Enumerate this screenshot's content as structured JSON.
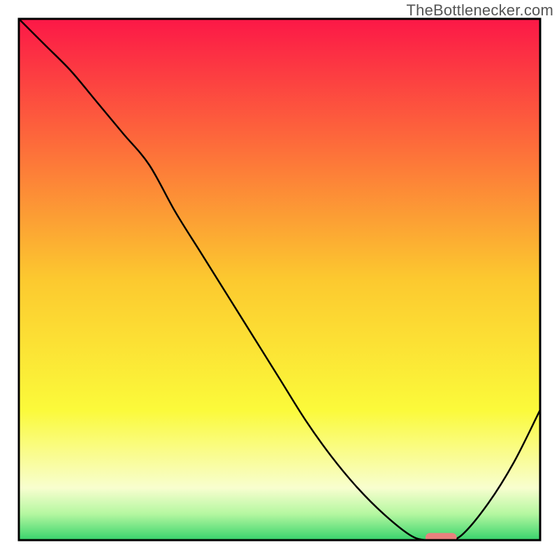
{
  "watermark": "TheBottlenecker.com",
  "chart_data": {
    "type": "line",
    "title": "",
    "xlabel": "",
    "ylabel": "",
    "xlim": [
      0,
      100
    ],
    "ylim": [
      0,
      100
    ],
    "grid": false,
    "legend": false,
    "x": [
      0,
      5,
      10,
      15,
      20,
      25,
      30,
      35,
      40,
      45,
      50,
      55,
      60,
      65,
      70,
      75,
      78,
      82,
      85,
      90,
      95,
      100
    ],
    "y": [
      100,
      95,
      90,
      84,
      78,
      72,
      63,
      55,
      47,
      39,
      31,
      23,
      16,
      10,
      5,
      1,
      0,
      0,
      1,
      7,
      15,
      25
    ],
    "series_color": "#000000",
    "marker": {
      "x_start": 78,
      "x_end": 84,
      "y": 0.5,
      "color": "#e8817e"
    },
    "gradient_bands": [
      {
        "y": 100,
        "color": "#fc1847"
      },
      {
        "y": 75,
        "color": "#fd6f3a"
      },
      {
        "y": 50,
        "color": "#fcc92f"
      },
      {
        "y": 25,
        "color": "#fbfa3a"
      },
      {
        "y": 10,
        "color": "#f8fecf"
      },
      {
        "y": 5,
        "color": "#b4f7a0"
      },
      {
        "y": 0,
        "color": "#37d36c"
      }
    ],
    "frame": true
  }
}
